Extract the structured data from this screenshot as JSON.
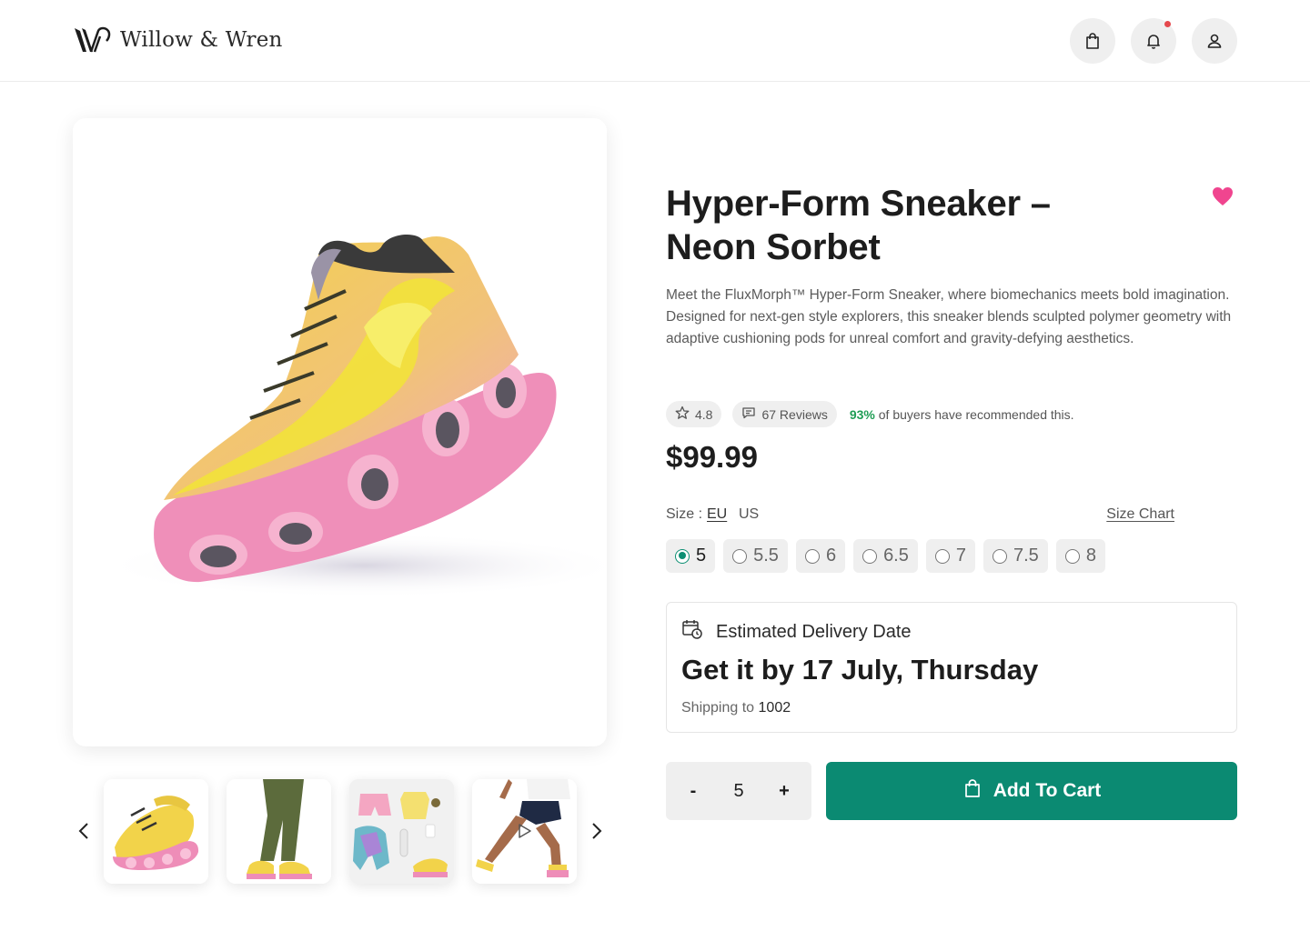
{
  "brand": {
    "name": "Willow & Wren",
    "logo_icon": "ww-monogram"
  },
  "header": {
    "icons": [
      "shopping-bag-icon",
      "bell-icon",
      "user-icon"
    ],
    "has_notification": true,
    "notification_color": "#e5484d"
  },
  "gallery": {
    "thumbnails": [
      {
        "name": "sneakers-pair",
        "selected": false
      },
      {
        "name": "model-legs-green-pants",
        "selected": false
      },
      {
        "name": "outfit-flatlay",
        "selected": false
      },
      {
        "name": "runner-video",
        "has_play_icon": true
      }
    ]
  },
  "product": {
    "title": "Hyper-Form Sneaker – Neon Sorbet",
    "favorite": true,
    "favorite_color": "#f0458f",
    "description": "Meet the FluxMorph™ Hyper-Form Sneaker, where biomechanics meets bold imagination. Designed for next-gen style explorers, this sneaker blends sculpted polymer geometry with adaptive cushioning pods for unreal comfort and gravity-defying aesthetics.",
    "rating": "4.8",
    "reviews": "67 Reviews",
    "recommend_pct": "93%",
    "recommend_text": "of buyers have recommended this.",
    "price": "$99.99"
  },
  "size": {
    "label": "Size :",
    "units": [
      "EU",
      "US"
    ],
    "active_unit": "EU",
    "chart_link": "Size Chart",
    "options": [
      "5",
      "5.5",
      "6",
      "6.5",
      "7",
      "7.5",
      "8"
    ],
    "selected": "5"
  },
  "delivery": {
    "heading": "Estimated Delivery Date",
    "date_text": "Get it by 17 July, Thursday",
    "shipping_label": "Shipping to",
    "zip": "1002"
  },
  "cart": {
    "minus": "-",
    "quantity": "5",
    "plus": "+",
    "button_label": "Add To Cart",
    "accent": "#0b8a72"
  }
}
